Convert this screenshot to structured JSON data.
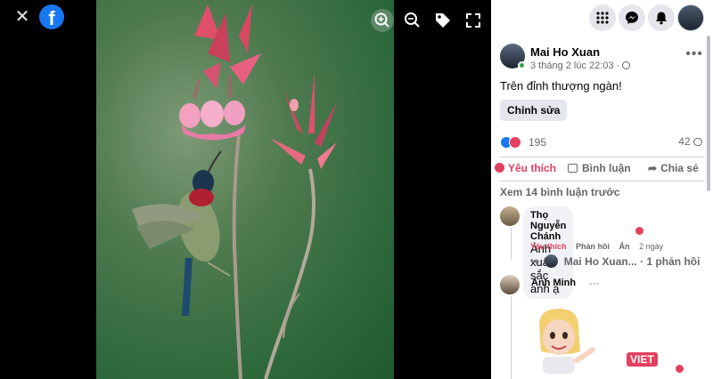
{
  "post": {
    "author": "Mai Ho Xuan",
    "time": "3 tháng 2 lúc 22:03",
    "text": "Trên đỉnh thượng ngàn!",
    "edit_label": "Chỉnh sửa",
    "reaction_count": "195",
    "comment_count": "42"
  },
  "actions": {
    "like": "Yêu thích",
    "comment": "Bình luận",
    "share": "Chia sẻ"
  },
  "comments": {
    "view_previous": "Xem 14 bình luận trước",
    "items": [
      {
        "author": "Thọ Nguyễn Chánh",
        "text": "Ảnh xuất sắc anh ạ",
        "like": "Yêu thích",
        "reply": "Phản hồi",
        "hide": "Ẩn",
        "age": "2 ngày",
        "reply_summary_name": "Mai Ho Xuan...",
        "reply_summary_count": "· 1 phản hồi"
      },
      {
        "author": "Anh Minh",
        "more": "···",
        "sticker_badge": "VIET"
      }
    ]
  },
  "icons": {
    "close": "close-icon",
    "facebook": "facebook-logo",
    "zoom_in": "zoom-in-icon",
    "zoom_out": "zoom-out-icon",
    "tag": "tag-icon",
    "fullscreen": "fullscreen-icon",
    "menu": "grid-menu-icon",
    "messenger": "messenger-icon",
    "notifications": "bell-icon"
  },
  "colors": {
    "brand": "#1877f2",
    "love": "#e4405f",
    "online": "#31a24c"
  }
}
